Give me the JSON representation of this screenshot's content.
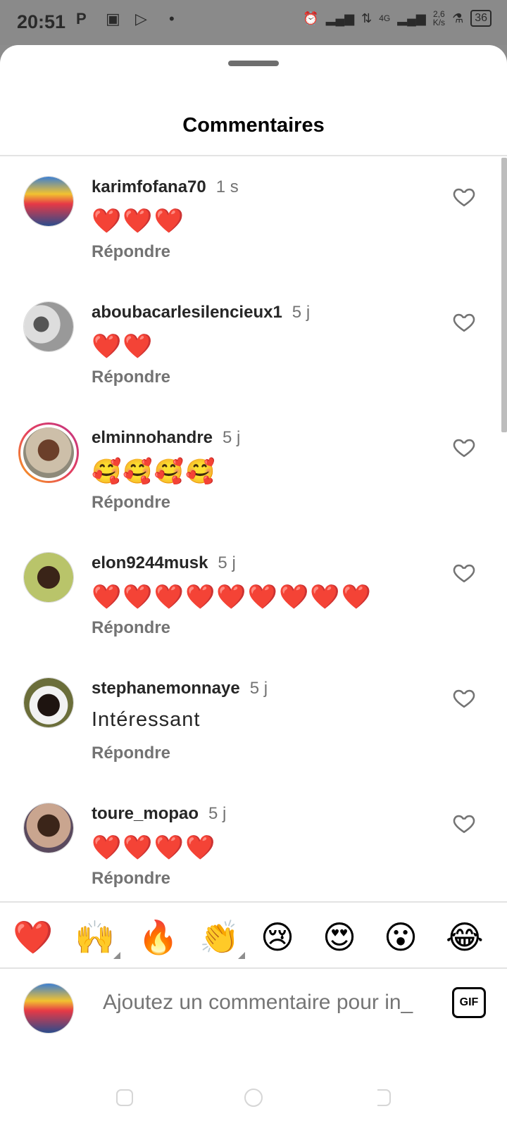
{
  "status_bar": {
    "time": "20:51",
    "network": "4G",
    "speed": "2,6\nK/s",
    "battery": "36"
  },
  "sheet": {
    "title": "Commentaires"
  },
  "comments": [
    {
      "username": "karimfofana70",
      "time": "1 s",
      "text": "❤️❤️❤️",
      "reply": "Répondre"
    },
    {
      "username": "aboubacarlesilencieux1",
      "time": "5 j",
      "text": "❤️❤️",
      "reply": "Répondre"
    },
    {
      "username": "elminnohandre",
      "time": "5 j",
      "text": "🥰🥰🥰🥰",
      "reply": "Répondre"
    },
    {
      "username": "elon9244musk",
      "time": "5 j",
      "text": "❤️❤️❤️❤️❤️❤️❤️❤️❤️",
      "reply": "Répondre"
    },
    {
      "username": "stephanemonnaye",
      "time": "5 j",
      "text": "Intéressant",
      "reply": "Répondre"
    },
    {
      "username": "toure_mopao",
      "time": "5 j",
      "text": "❤️❤️❤️❤️",
      "reply": "Répondre"
    }
  ],
  "emoji_bar": [
    "❤️",
    "🙌",
    "🔥",
    "👏",
    "😢",
    "😍",
    "😮",
    "😂"
  ],
  "composer": {
    "placeholder": "Ajoutez un commentaire pour in_",
    "gif_label": "GIF"
  },
  "colors": {
    "accent_heart": "#e0202f",
    "muted_text": "#737373"
  }
}
